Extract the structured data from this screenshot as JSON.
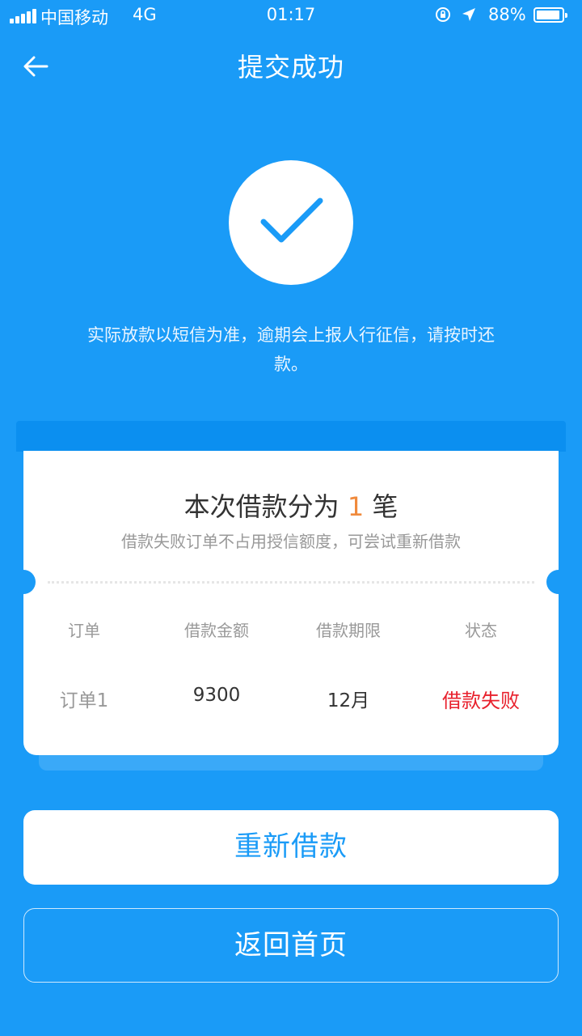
{
  "status_bar": {
    "carrier": "中国移动",
    "network": "4G",
    "time": "01:17",
    "battery_pct": "88%"
  },
  "nav": {
    "title": "提交成功"
  },
  "success": {
    "notice": "实际放款以短信为准，逾期会上报人行征信，请按时还款。"
  },
  "card": {
    "title_prefix": "本次借款分为",
    "title_count": "1",
    "title_suffix": "笔",
    "subtitle": "借款失败订单不占用授信额度，可尝试重新借款",
    "columns": [
      "订单",
      "借款金额",
      "借款期限",
      "状态"
    ],
    "rows": [
      {
        "order": "订单1",
        "amount": "9300",
        "term": "12月",
        "status": "借款失败"
      }
    ]
  },
  "buttons": {
    "retry": "重新借款",
    "home": "返回首页"
  },
  "colors": {
    "background": "#1a9bf7",
    "count_accent": "#f08a3c",
    "status_fail": "#e8202c"
  }
}
